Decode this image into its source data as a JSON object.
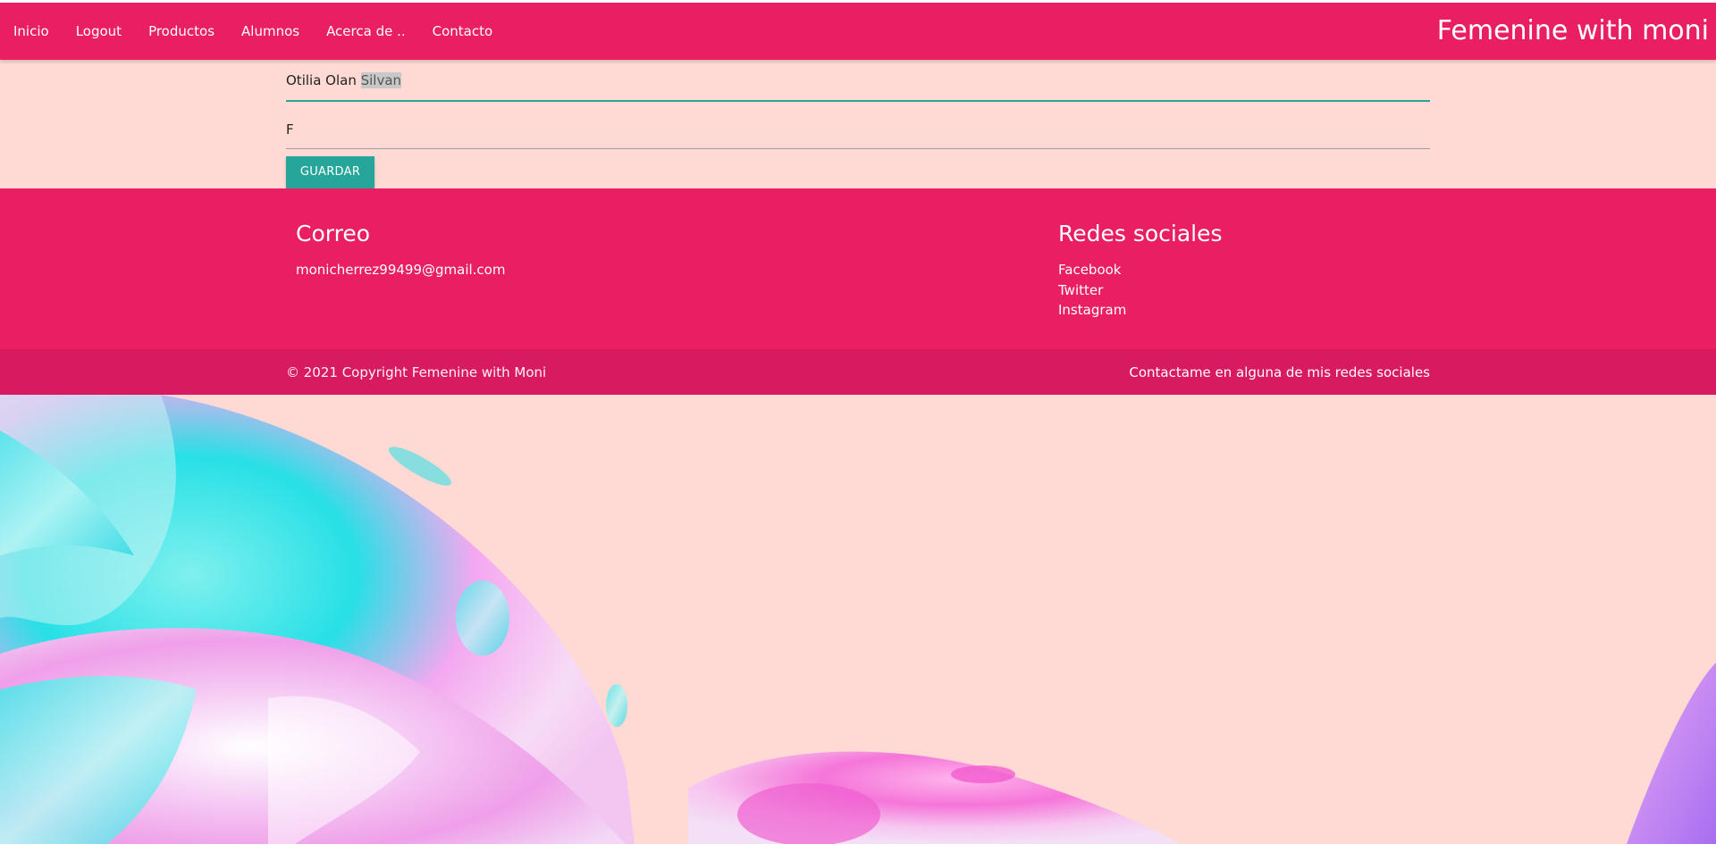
{
  "nav": {
    "links": [
      "Inicio",
      "Logout",
      "Productos",
      "Alumnos",
      "Acerca de ..",
      "Contacto"
    ],
    "brand": "Femenine with moni"
  },
  "form": {
    "name_plain": "Otilia Olan ",
    "name_selected": "Silvan",
    "gender": "F",
    "save_label": "GUARDAR"
  },
  "footer": {
    "email_title": "Correo",
    "email": "monicherrez99499@gmail.com",
    "social_title": "Redes sociales",
    "social_links": [
      "Facebook",
      "Twitter",
      "Instagram"
    ],
    "copyright": "© 2021 Copyright Femenine with Moni",
    "contact_note": "Contactame en alguna de mis redes sociales"
  },
  "colors": {
    "primary": "#e91e63",
    "primary_dark": "#d81b60",
    "accent": "#26a69a",
    "background": "#ffd9d4"
  }
}
